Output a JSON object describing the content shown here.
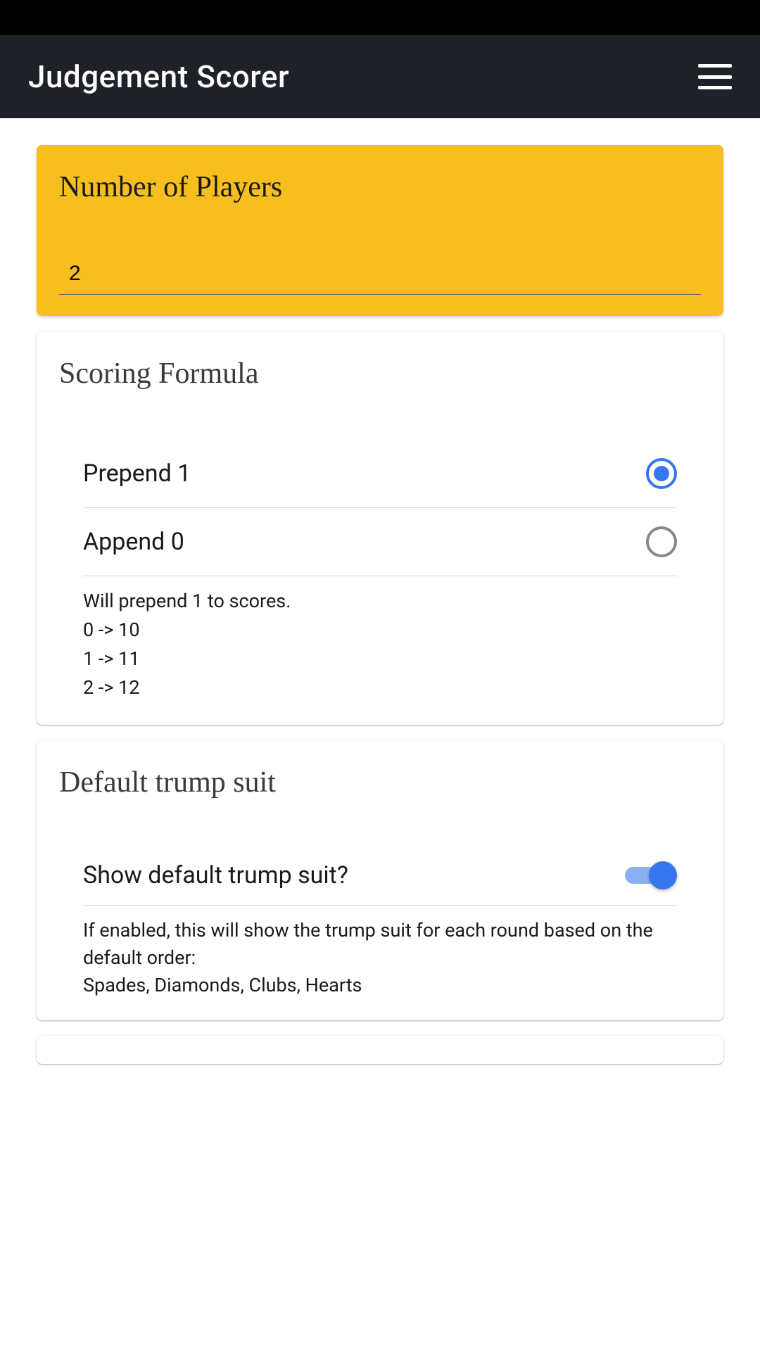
{
  "header": {
    "title": "Judgement Scorer"
  },
  "players_card": {
    "title": "Number of Players",
    "value": "2"
  },
  "scoring_card": {
    "title": "Scoring Formula",
    "options": [
      {
        "label": "Prepend 1",
        "selected": true
      },
      {
        "label": "Append 0",
        "selected": false
      }
    ],
    "description": {
      "intro": "Will prepend 1 to scores.",
      "lines": [
        "0 -> 10",
        "1 -> 11",
        "2 -> 12"
      ]
    }
  },
  "trump_card": {
    "title": "Default trump suit",
    "toggle_label": "Show default trump suit?",
    "toggle_on": true,
    "desc_line1": "If enabled, this will show the trump suit for each round based on the default order:",
    "desc_line2": "Spades, Diamonds, Clubs, Hearts"
  }
}
